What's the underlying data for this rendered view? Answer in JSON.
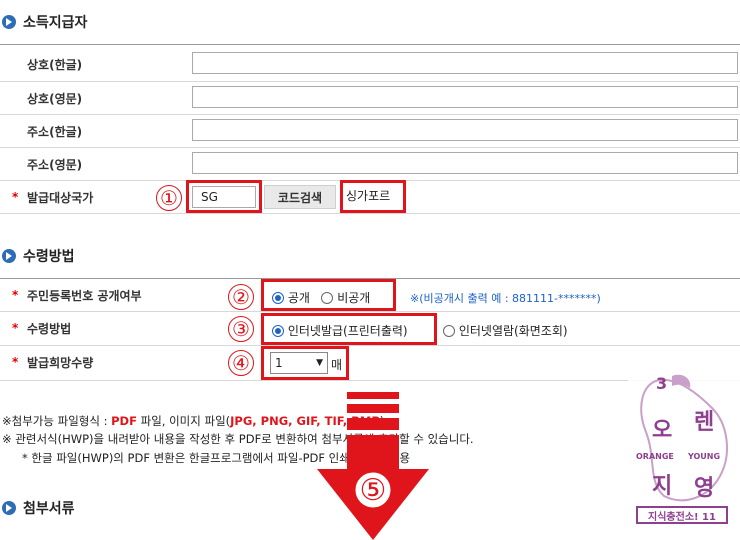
{
  "sections": {
    "issuer": "소득지급자",
    "receive": "수령방법",
    "attach": "첨부서류"
  },
  "issuer_fields": [
    {
      "label": "상호(한글)"
    },
    {
      "label": "상호(영문)"
    },
    {
      "label": "주소(한글)"
    },
    {
      "label": "주소(영문)"
    }
  ],
  "country": {
    "label": "발급대상국가",
    "code_value": "SG",
    "search_button": "코드검색",
    "country_name": "싱가포르"
  },
  "disclosure": {
    "label": "주민등록번호 공개여부",
    "option_public": "공개",
    "option_private": "비공개",
    "note": "※(비공개시 출력 예 : 881111-*******)"
  },
  "method": {
    "label": "수령방법",
    "option_print": "인터넷발급(프린터출력)",
    "option_view": "인터넷열람(화면조회)"
  },
  "quantity": {
    "label": "발급희망수량",
    "value": "1",
    "unit": "매"
  },
  "notes": {
    "line1_prefix": "※첨부가능 파일형식 : ",
    "line1_pdf": "PDF",
    "line1_mid": " 파일, 이미지 파일(",
    "line1_formats": "JPG, PNG, GIF, TIF, BMP",
    "line1_suffix": ")",
    "line2": "※ 관련서식(HWP)을 내려받아 내용을 작성한 후 PDF로 변환하여 첨부서류에 추가할 수 있습니다.",
    "line3": "* 한글 파일(HWP)의 PDF 변환은 한글프로그램에서 파일-PDF 인쇄 기능을 이용"
  },
  "annotations": [
    "①",
    "②",
    "③",
    "④",
    "⑤"
  ],
  "watermark": {
    "num": "3",
    "chars": [
      "오",
      "렌",
      "지",
      "영"
    ],
    "en_left": "ORANGE",
    "en_right": "YOUNG",
    "footer": "지식충전소! 11"
  },
  "colors": {
    "accent_red": "#e0151b",
    "section_icon": "#2d6db5",
    "watermark_purple": "#8e3f8e"
  }
}
